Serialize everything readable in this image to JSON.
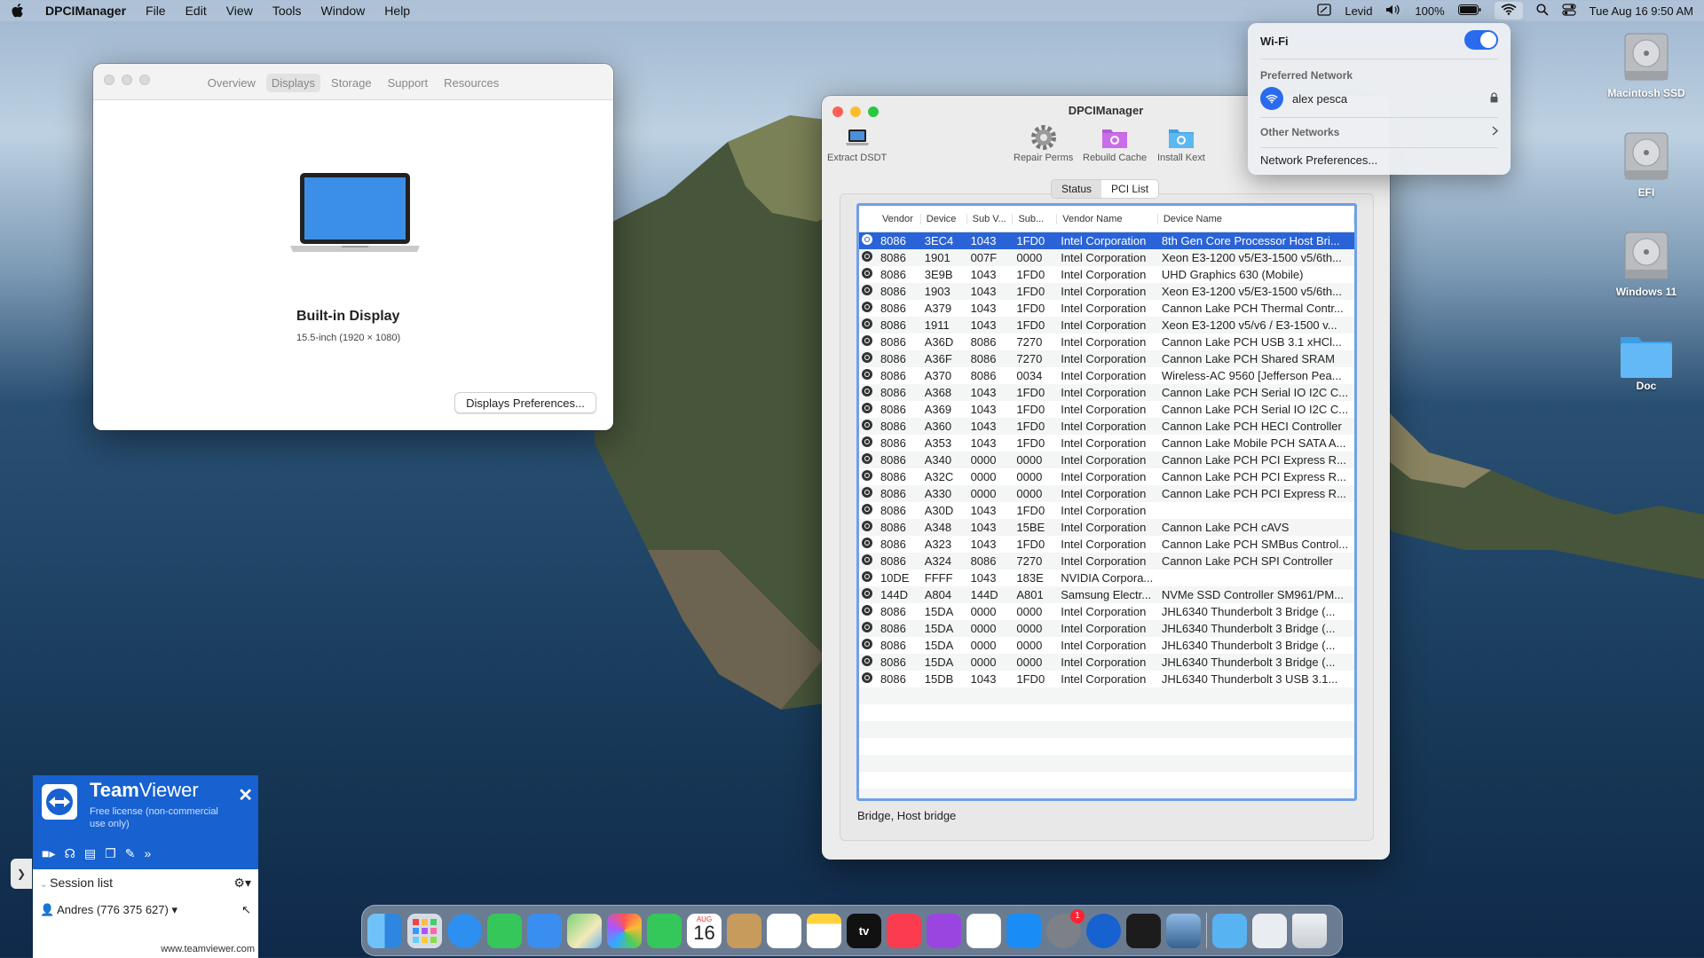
{
  "menubar": {
    "app_name": "DPCIManager",
    "items": [
      "File",
      "Edit",
      "View",
      "Tools",
      "Window",
      "Help"
    ],
    "user": "Levid",
    "battery": "100%",
    "datetime": "Tue Aug 16  9:50 AM"
  },
  "about_window": {
    "tabs": [
      "Overview",
      "Displays",
      "Storage",
      "Support",
      "Resources"
    ],
    "selected_tab": "Displays",
    "display_name": "Built-in Display",
    "display_size": "15.5-inch (1920 × 1080)",
    "prefs_button": "Displays Preferences..."
  },
  "dpci": {
    "title": "DPCIManager",
    "toolbar": {
      "extract": "Extract DSDT",
      "repair": "Repair Perms",
      "rebuild": "Rebuild Cache",
      "install": "Install Kext"
    },
    "segments": [
      "Status",
      "PCI List"
    ],
    "selected_segment": "PCI List",
    "columns": [
      "Vendor",
      "Device",
      "Sub V...",
      "Sub...",
      "Vendor Name",
      "Device Name"
    ],
    "rows": [
      [
        "8086",
        "3EC4",
        "1043",
        "1FD0",
        "Intel Corporation",
        "8th Gen Core Processor Host Bri..."
      ],
      [
        "8086",
        "1901",
        "007F",
        "0000",
        "Intel Corporation",
        "Xeon E3-1200 v5/E3-1500 v5/6th..."
      ],
      [
        "8086",
        "3E9B",
        "1043",
        "1FD0",
        "Intel Corporation",
        "UHD Graphics 630 (Mobile)"
      ],
      [
        "8086",
        "1903",
        "1043",
        "1FD0",
        "Intel Corporation",
        "Xeon E3-1200 v5/E3-1500 v5/6th..."
      ],
      [
        "8086",
        "A379",
        "1043",
        "1FD0",
        "Intel Corporation",
        "Cannon Lake PCH Thermal Contr..."
      ],
      [
        "8086",
        "1911",
        "1043",
        "1FD0",
        "Intel Corporation",
        "Xeon E3-1200 v5/v6 / E3-1500 v..."
      ],
      [
        "8086",
        "A36D",
        "8086",
        "7270",
        "Intel Corporation",
        "Cannon Lake PCH USB 3.1 xHCl..."
      ],
      [
        "8086",
        "A36F",
        "8086",
        "7270",
        "Intel Corporation",
        "Cannon Lake PCH Shared SRAM"
      ],
      [
        "8086",
        "A370",
        "8086",
        "0034",
        "Intel Corporation",
        "Wireless-AC 9560 [Jefferson Pea..."
      ],
      [
        "8086",
        "A368",
        "1043",
        "1FD0",
        "Intel Corporation",
        "Cannon Lake PCH Serial IO I2C C..."
      ],
      [
        "8086",
        "A369",
        "1043",
        "1FD0",
        "Intel Corporation",
        "Cannon Lake PCH Serial IO I2C C..."
      ],
      [
        "8086",
        "A360",
        "1043",
        "1FD0",
        "Intel Corporation",
        "Cannon Lake PCH HECI Controller"
      ],
      [
        "8086",
        "A353",
        "1043",
        "1FD0",
        "Intel Corporation",
        "Cannon Lake Mobile PCH SATA A..."
      ],
      [
        "8086",
        "A340",
        "0000",
        "0000",
        "Intel Corporation",
        "Cannon Lake PCH PCI Express R..."
      ],
      [
        "8086",
        "A32C",
        "0000",
        "0000",
        "Intel Corporation",
        "Cannon Lake PCH PCI Express R..."
      ],
      [
        "8086",
        "A330",
        "0000",
        "0000",
        "Intel Corporation",
        "Cannon Lake PCH PCI Express R..."
      ],
      [
        "8086",
        "A30D",
        "1043",
        "1FD0",
        "Intel Corporation",
        ""
      ],
      [
        "8086",
        "A348",
        "1043",
        "15BE",
        "Intel Corporation",
        "Cannon Lake PCH cAVS"
      ],
      [
        "8086",
        "A323",
        "1043",
        "1FD0",
        "Intel Corporation",
        "Cannon Lake PCH SMBus Control..."
      ],
      [
        "8086",
        "A324",
        "8086",
        "7270",
        "Intel Corporation",
        "Cannon Lake PCH SPI Controller"
      ],
      [
        "10DE",
        "FFFF",
        "1043",
        "183E",
        "NVIDIA Corpora...",
        ""
      ],
      [
        "144D",
        "A804",
        "144D",
        "A801",
        "Samsung Electr...",
        "NVMe SSD Controller SM961/PM..."
      ],
      [
        "8086",
        "15DA",
        "0000",
        "0000",
        "Intel Corporation",
        "JHL6340 Thunderbolt 3 Bridge (..."
      ],
      [
        "8086",
        "15DA",
        "0000",
        "0000",
        "Intel Corporation",
        "JHL6340 Thunderbolt 3 Bridge (..."
      ],
      [
        "8086",
        "15DA",
        "0000",
        "0000",
        "Intel Corporation",
        "JHL6340 Thunderbolt 3 Bridge (..."
      ],
      [
        "8086",
        "15DA",
        "0000",
        "0000",
        "Intel Corporation",
        "JHL6340 Thunderbolt 3 Bridge (..."
      ],
      [
        "8086",
        "15DB",
        "1043",
        "1FD0",
        "Intel Corporation",
        "JHL6340 Thunderbolt 3 USB 3.1..."
      ]
    ],
    "selected_row": 0,
    "status_text": "Bridge, Host bridge"
  },
  "wifi_panel": {
    "title": "Wi-Fi",
    "enabled": true,
    "preferred_label": "Preferred Network",
    "network": "alex pesca",
    "other_label": "Other Networks",
    "prefs_link": "Network Preferences..."
  },
  "desktop_icons": [
    "Macintosh SSD",
    "EFI",
    "Windows 11",
    "Doc"
  ],
  "teamviewer": {
    "brand_a": "Team",
    "brand_b": "Viewer",
    "license": "Free license (non-commercial use only)",
    "session_list": "Session list",
    "user": "Andres (776 375 627)",
    "url": "www.teamviewer.com"
  },
  "dock": {
    "calendar_month": "AUG",
    "calendar_day": "16",
    "tv_label": "tv",
    "settings_badge": "1"
  },
  "colors": {
    "accent": "#2a63d7",
    "teamviewer_blue": "#1761d1",
    "toggle_on": "#2a6bee"
  }
}
